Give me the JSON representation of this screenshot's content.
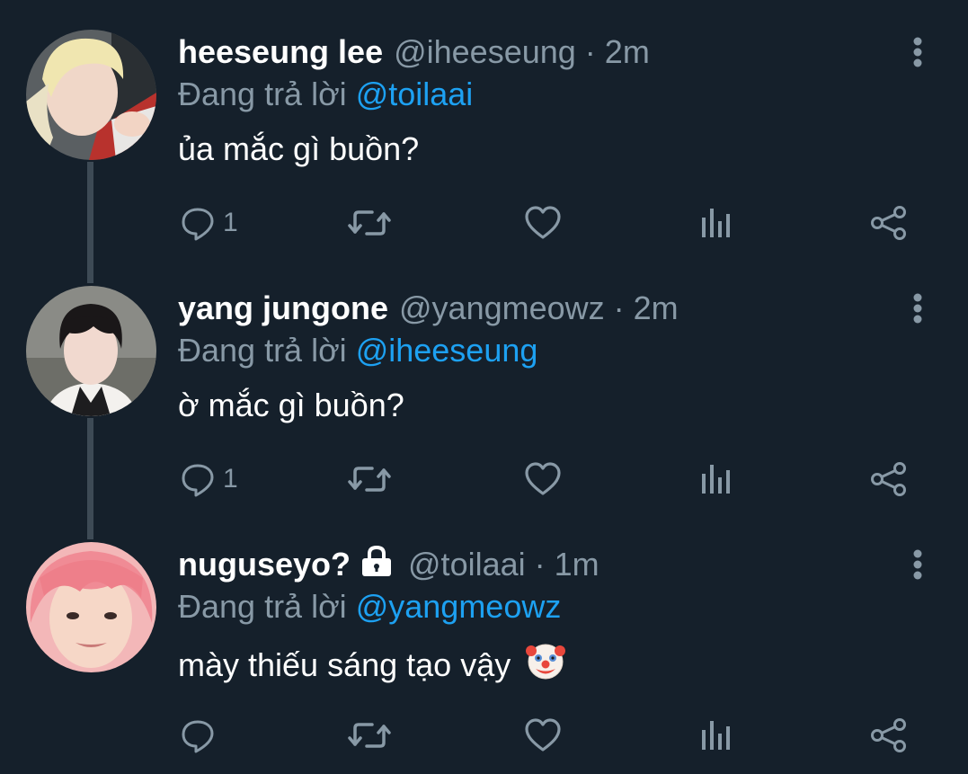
{
  "colors": {
    "background": "#15202b",
    "muted": "#8899a6",
    "accent": "#1da1f2",
    "thread_line": "#3d4a55"
  },
  "tweets": [
    {
      "name": "heeseung lee",
      "handle": "@iheeseung",
      "separator": "·",
      "time": "2m",
      "reply_prefix": "Đang trả lời",
      "reply_to": "@toilaai",
      "text": "ủa mắc gì buồn?",
      "reply_count": "1",
      "protected": false,
      "avatar": "avatar-blonde"
    },
    {
      "name": "yang jungone",
      "handle": "@yangmeowz",
      "separator": "·",
      "time": "2m",
      "reply_prefix": "Đang trả lời",
      "reply_to": "@iheeseung",
      "text": "ờ mắc gì buồn?",
      "reply_count": "1",
      "protected": false,
      "avatar": "avatar-dark-hair"
    },
    {
      "name": "nuguseyo?",
      "handle": "@toilaai",
      "separator": "·",
      "time": "1m",
      "reply_prefix": "Đang trả lời",
      "reply_to": "@yangmeowz",
      "text": "mày thiếu sáng tạo vậy",
      "reply_count": "",
      "protected": true,
      "emoji": "clown-face",
      "avatar": "avatar-pink-hair"
    }
  ],
  "icons": {
    "reply": "reply-icon",
    "retweet": "retweet-icon",
    "like": "like-icon",
    "analytics": "analytics-icon",
    "share": "share-icon",
    "more": "more-vertical-icon",
    "lock": "lock-icon"
  }
}
